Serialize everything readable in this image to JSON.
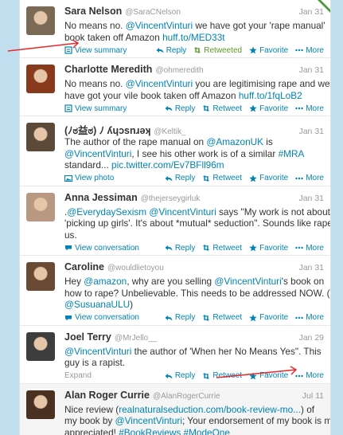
{
  "actions": {
    "reply": "Reply",
    "retweet": "Retweet",
    "retweeted": "Retweeted",
    "favorite": "Favorite",
    "more": "More"
  },
  "tweets": [
    {
      "name": "Sara Nelson",
      "handle": "@SaraCNelson",
      "time": "Jan 31",
      "lines": [
        [
          {
            "t": "No means no. "
          },
          {
            "t": "@VincentVinturi",
            "l": true
          },
          {
            "t": " we have got your 'rape manual'"
          }
        ],
        [
          {
            "t": "book taken off Amazon "
          },
          {
            "t": "huff.to/MED33t",
            "l": true
          }
        ]
      ],
      "expand": "View summary",
      "retweeted": true,
      "avatar": "#7a6a55"
    },
    {
      "name": "Charlotte Meredith",
      "handle": "@ohmeredith",
      "time": "Jan 31",
      "lines": [
        [
          {
            "t": "No means no. "
          },
          {
            "t": "@VincentVinturi",
            "l": true
          },
          {
            "t": " you are legitimising rape and we"
          }
        ],
        [
          {
            "t": "have got your vile book taken off Amazon "
          },
          {
            "t": "huff.to/1fqLoB2",
            "l": true
          }
        ]
      ],
      "expand": "View summary",
      "avatar": "#8a3a1c"
    },
    {
      "name": "(ﾉಠ益ಠ) ﾉ ʎɥɔsnɹǝʞ",
      "handle": "@Keltik_",
      "time": "Jan 31",
      "lines": [
        [
          {
            "t": "The author of the rape manual on "
          },
          {
            "t": "@AmazonUK",
            "l": true
          },
          {
            "t": " is"
          }
        ],
        [
          {
            "t": "@VincentVinturi",
            "l": true
          },
          {
            "t": ", I see his other work is of a similar "
          },
          {
            "t": "#MRA",
            "l": true
          }
        ],
        [
          {
            "t": "standard... "
          },
          {
            "t": "pic.twitter.com/Ev7BFll96m",
            "l": true
          }
        ]
      ],
      "expand": "View photo",
      "avatar": "#5b4a3a"
    },
    {
      "name": "Anna Jessiman",
      "handle": "@thejerseygirluk",
      "time": "Jan 31",
      "lines": [
        [
          {
            "t": "."
          },
          {
            "t": "@EverydaySexism",
            "l": true
          },
          {
            "t": " "
          },
          {
            "t": "@VincentVinturi",
            "l": true
          },
          {
            "t": " says \"My work is not about"
          }
        ],
        [
          {
            "t": "'picking up girls'. It's about *mutual* seduction\". Sounds like rape to"
          }
        ],
        [
          {
            "t": "us."
          }
        ]
      ],
      "expand": "View conversation",
      "avatar": "#b89880"
    },
    {
      "name": "Caroline",
      "handle": "@wouldlietoyou",
      "time": "Jan 31",
      "lines": [
        [
          {
            "t": "Hey "
          },
          {
            "t": "@amazon",
            "l": true
          },
          {
            "t": ", why are you selling "
          },
          {
            "t": "@VincentVinturi",
            "l": true
          },
          {
            "t": "'s book on"
          }
        ],
        [
          {
            "t": "how to rape? Unbelievable. This needs to be addressed NOW. (Via"
          }
        ],
        [
          {
            "t": "@SusuanaULU",
            "l": true
          },
          {
            "t": ")"
          }
        ]
      ],
      "expand": "View conversation",
      "avatar": "#6b4a35"
    },
    {
      "name": "Joel Terry",
      "handle": "@MrJello__",
      "time": "Jan 29",
      "lines": [
        [
          {
            "t": "@VincentVinturi",
            "l": true
          },
          {
            "t": " the author of 'When her No Means Yes\". This"
          }
        ],
        [
          {
            "t": "guy is a rapist."
          }
        ]
      ],
      "expand": "Expand",
      "expandGray": true,
      "avatar": "#3d3d3d"
    },
    {
      "name": "Alan Roger Currie",
      "handle": "@AlanRogerCurrie",
      "time": "Jul 11",
      "lines": [
        [
          {
            "t": "Nice review ("
          },
          {
            "t": "realnaturalseduction.com/book-review-mo...",
            "l": true
          },
          {
            "t": ") of"
          }
        ],
        [
          {
            "t": "my book by "
          },
          {
            "t": "@VincentVinturi",
            "l": true
          },
          {
            "t": "; Your endorsement of my book is much"
          }
        ],
        [
          {
            "t": "appreciated! "
          },
          {
            "t": "#BookReviews",
            "l": true
          },
          {
            "t": " "
          },
          {
            "t": "#ModeOne",
            "l": true
          }
        ]
      ],
      "expand": "Expand",
      "expandGray": true,
      "highlight": true,
      "avatar": "#4a3020"
    }
  ],
  "colors": {
    "link": "#0084b4",
    "muted": "#999999",
    "retweeted": "#609928",
    "background": "#c0deed",
    "annotation_arrow": "#e8282b"
  }
}
